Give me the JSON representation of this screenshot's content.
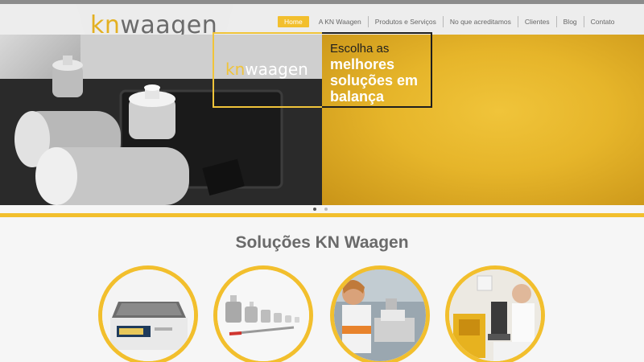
{
  "brand": {
    "logo_prefix": "kn",
    "logo_suffix": "waagen",
    "accent": "#f2bf2d",
    "text_gray": "#6b6b6b"
  },
  "nav": {
    "items": [
      {
        "label": "Home",
        "active": true
      },
      {
        "label": "A KN Waagen",
        "active": false
      },
      {
        "label": "Produtos e Serviços",
        "active": false
      },
      {
        "label": "No que acreditamos",
        "active": false
      },
      {
        "label": "Clientes",
        "active": false
      },
      {
        "label": "Blog",
        "active": false
      },
      {
        "label": "Contato",
        "active": false
      }
    ]
  },
  "hero": {
    "logo_prefix": "kn",
    "logo_suffix": "waagen",
    "line1": "Escolha as",
    "line2": "melhores",
    "line3": "soluções em",
    "line4": "balança",
    "slides": 2,
    "active_slide": 1
  },
  "solutions": {
    "title": "Soluções KN Waagen",
    "items": [
      {
        "icon": "precision-scale-image"
      },
      {
        "icon": "calibration-weights-image"
      },
      {
        "icon": "lab-technician-image"
      },
      {
        "icon": "lab-equipment-image"
      }
    ]
  }
}
